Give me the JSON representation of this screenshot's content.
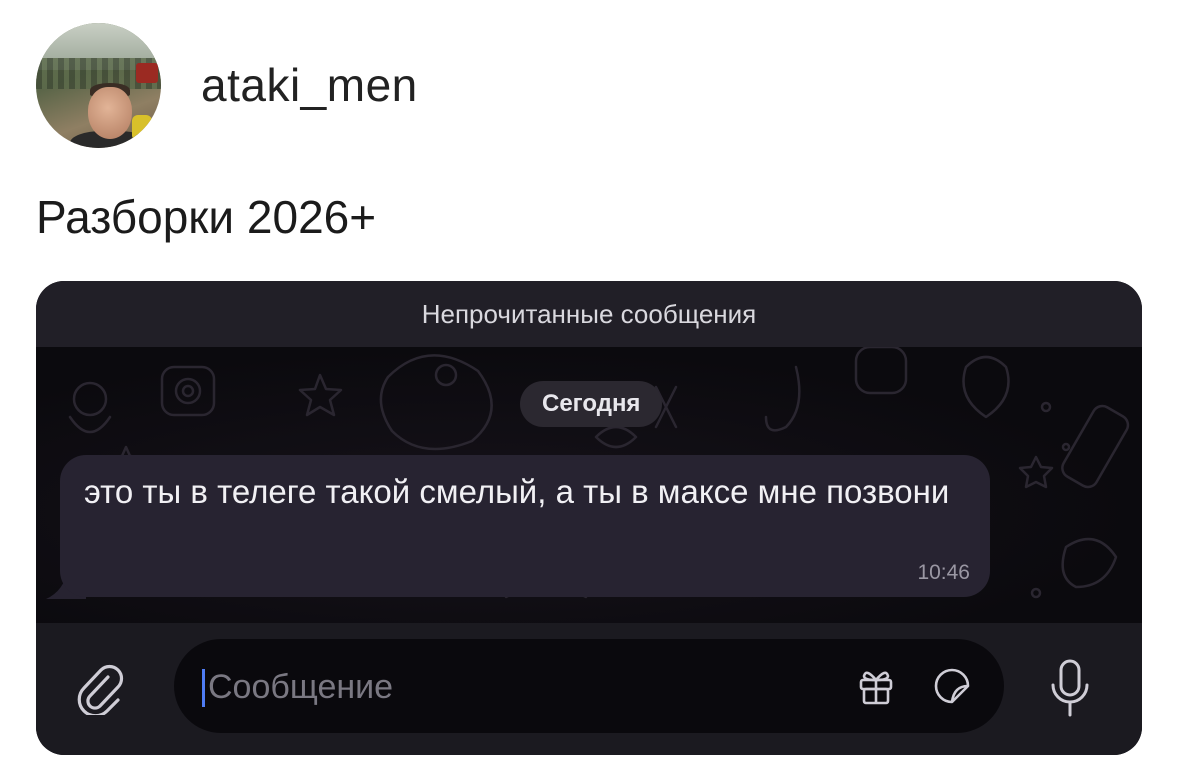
{
  "post": {
    "username": "ataki_men",
    "caption": "Разборки 2026+"
  },
  "chat": {
    "unread_banner": "Непрочитанные сообщения",
    "date_label": "Сегодня",
    "message": {
      "text": "это ты в телеге такой смелый, а ты в максе мне позвони",
      "time": "10:46"
    },
    "input": {
      "placeholder": "Сообщение"
    },
    "icons": [
      "avatar",
      "paperclip-icon",
      "gift-icon",
      "sticker-icon",
      "microphone-icon"
    ],
    "colors": {
      "background": "#09080d",
      "bubble": "#272331",
      "caret": "#4f7cf4"
    }
  }
}
